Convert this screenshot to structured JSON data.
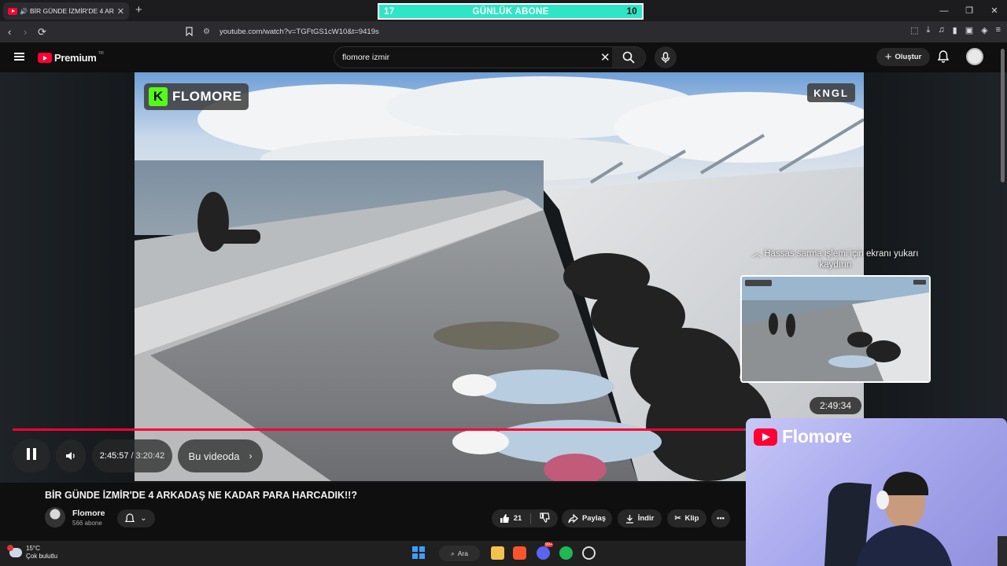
{
  "browser": {
    "tab_title": "BİR GÜNDE İZMİR'DE 4 ARKA",
    "tab_close": "✕",
    "new_tab": "+",
    "url": "youtube.com/watch?v=TGFtGS1cW10&t=9419s",
    "window_controls": [
      "—",
      "❐",
      "✕"
    ]
  },
  "subscriber_overlay": {
    "left_value": "17",
    "title": "GÜNLÜK ABONE",
    "right_value": "10"
  },
  "youtube_header": {
    "logo_text": "Premium",
    "logo_region": "TR",
    "search_value": "flomore izmir",
    "create_label": "Oluştur"
  },
  "video": {
    "watermark_left": "FLOMORE",
    "watermark_left_icon": "K",
    "watermark_right": "KNGL",
    "scrub_hint": "Hassas sarma işlemi için ekranı yukarı kaydırın",
    "preview_time": "2:49:34",
    "current_time": "2:45:57",
    "duration": "3:20:42",
    "time_separator": "/",
    "chapter_label": "Bu videoda",
    "progress_fraction": 0.745,
    "progress_color": "#ff0033"
  },
  "video_info": {
    "title": "BİR GÜNDE İZMİR'DE 4 ARKADAŞ NE KADAR PARA HARCADIK!!?",
    "channel_name": "Flomore",
    "channel_subs": "566 abone",
    "like_count": "21",
    "share_label": "Paylaş",
    "download_label": "İndir",
    "clip_label": "Klip"
  },
  "webcam": {
    "channel_label": "Flomore"
  },
  "taskbar": {
    "temperature": "15°C",
    "weather": "Çok bulutlu",
    "search_label": "Ara",
    "discord_badge": "99+"
  },
  "colors": {
    "subbar": "#2ee6c5",
    "youtube_red": "#ff0033",
    "kick_green": "#53fc18",
    "webcam_bg": "#a9a9ee"
  }
}
